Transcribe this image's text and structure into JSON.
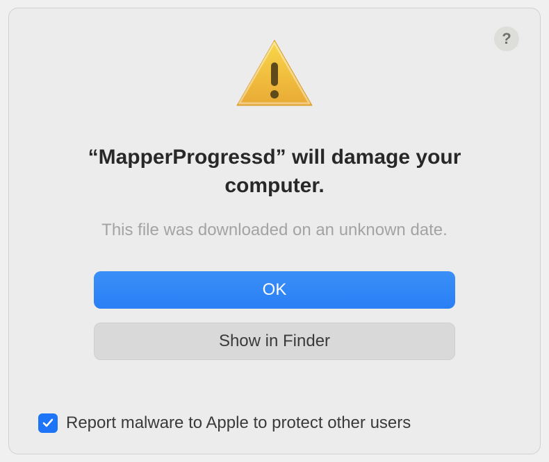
{
  "dialog": {
    "help_tooltip": "?",
    "heading": "“MapperProgressd” will damage your computer.",
    "subtext": "This file was downloaded on an unknown date.",
    "primary_button": "OK",
    "secondary_button": "Show in Finder",
    "checkbox_label": "Report malware to Apple to protect other users",
    "checkbox_checked": true
  }
}
